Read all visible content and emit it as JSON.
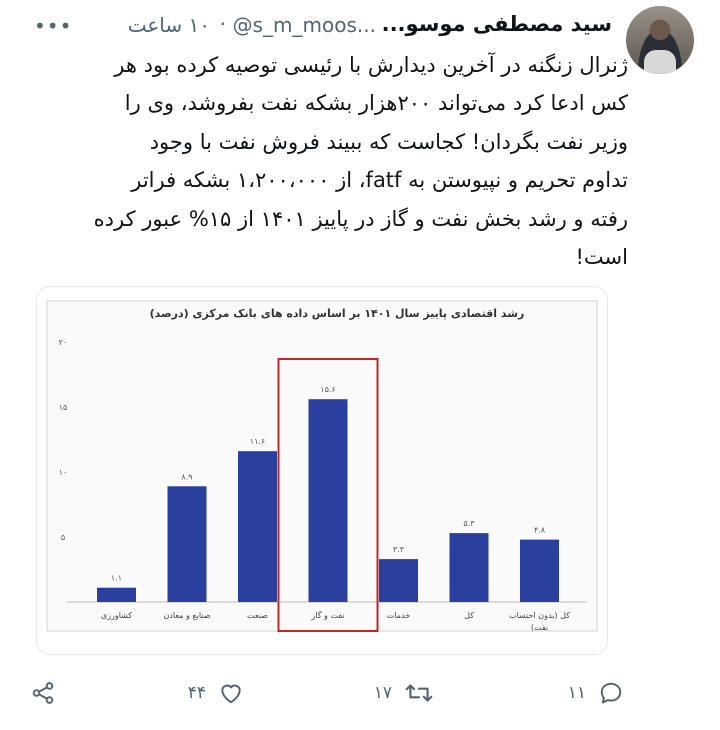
{
  "tweet": {
    "author_name": "سید مصطفی موسو...",
    "handle": "@s_m_moos...",
    "separator": "·",
    "time": "۱۰ ساعت",
    "lines": [
      "ژنرال زنگنه در آخرین دیدارش با رئیسی توصیه کرده بود هر",
      "کس ادعا کرد می‌تواند ۲۰۰هزار بشکه نفت بفروشد، وی را",
      "وزیر نفت بگردان! کجاست که ببیند فروش نفت با وجود",
      "تداوم تحریم و نپیوستن به fatf، از ۱،۲۰۰،۰۰۰ بشکه فراتر",
      "رفته و رشد بخش نفت و گاز در پاییز ۱۴۰۱ از ۱۵% عبور کرده",
      "است!"
    ]
  },
  "chart_data": {
    "type": "bar",
    "title": "رشد اقتصادی پاییز سال ۱۴۰۱ بر اساس داده های بانک مرکزی (درصد)",
    "categories": [
      [
        "کشاورزی"
      ],
      [
        "صنایع و معادن"
      ],
      [
        "صنعت"
      ],
      [
        "نفت و گاز"
      ],
      [
        "خدمات"
      ],
      [
        "کل"
      ],
      [
        "کل (بدون احتساب",
        "نفت)"
      ]
    ],
    "values": [
      1.1,
      8.9,
      11.6,
      15.6,
      3.3,
      5.3,
      4.8
    ],
    "value_labels": [
      "۱.۱",
      "۸.۹",
      "۱۱.۶",
      "۱۵.۶",
      "۳.۳",
      "۵.۳",
      "۴.۸"
    ],
    "ylim": [
      0,
      20
    ],
    "yticks": [
      {
        "value": 20,
        "label": "۲۰"
      },
      {
        "value": 15,
        "label": "۱۵"
      },
      {
        "value": 10,
        "label": "۱۰"
      },
      {
        "value": 5,
        "label": "۵"
      }
    ],
    "highlight_index": 3,
    "bar_color": "#2a3f9e",
    "highlight_color": "#c0272d",
    "grid": false
  },
  "actions": {
    "reply_count": "۱۱",
    "retweet_count": "۱۷",
    "like_count": "۴۴",
    "reply_icon": "reply-icon",
    "retweet_icon": "retweet-icon",
    "like_icon": "heart-icon",
    "share_icon": "share-icon"
  },
  "colors": {
    "text": "#0f1419",
    "secondary": "#536471"
  }
}
